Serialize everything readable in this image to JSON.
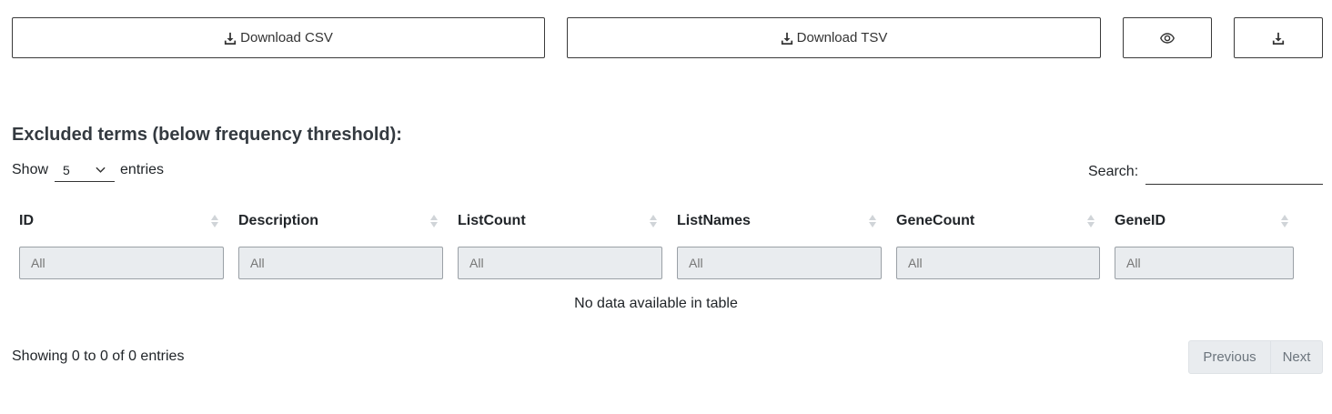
{
  "toolbar": {
    "download_csv": "Download CSV",
    "download_tsv": "Download TSV",
    "view_icon": "eye-icon",
    "download_icon": "download-icon"
  },
  "section": {
    "title": "Excluded terms (below frequency threshold):"
  },
  "length_menu": {
    "show_label": "Show",
    "value": "5",
    "entries_label": "entries"
  },
  "search": {
    "label": "Search:",
    "value": ""
  },
  "table": {
    "columns": [
      {
        "label": "ID",
        "filter_placeholder": "All"
      },
      {
        "label": "Description",
        "filter_placeholder": "All"
      },
      {
        "label": "ListCount",
        "filter_placeholder": "All"
      },
      {
        "label": "ListNames",
        "filter_placeholder": "All"
      },
      {
        "label": "GeneCount",
        "filter_placeholder": "All"
      },
      {
        "label": "GeneID",
        "filter_placeholder": "All"
      }
    ],
    "empty_message": "No data available in table"
  },
  "footer": {
    "info": "Showing 0 to 0 of 0 entries",
    "previous": "Previous",
    "next": "Next"
  },
  "colors": {
    "border": "#3a3a3a",
    "filter_bg": "#e9ecef",
    "title": "#343a40"
  }
}
